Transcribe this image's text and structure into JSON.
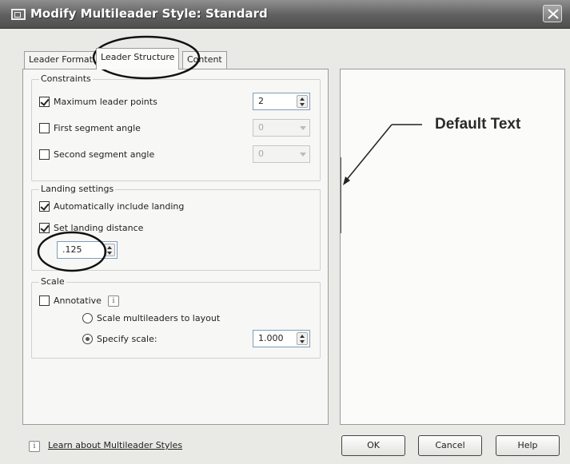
{
  "window": {
    "title": "Modify Multileader Style: Standard"
  },
  "tabs": [
    {
      "label": "Leader Format"
    },
    {
      "label": "Leader Structure"
    },
    {
      "label": "Content"
    }
  ],
  "constraints": {
    "group_label": "Constraints",
    "max_leader_points": {
      "label": "Maximum leader points",
      "checked": true,
      "value": "2"
    },
    "first_segment_angle": {
      "label": "First segment angle",
      "checked": false,
      "value": "0"
    },
    "second_segment_angle": {
      "label": "Second segment angle",
      "checked": false,
      "value": "0"
    }
  },
  "landing": {
    "group_label": "Landing settings",
    "auto_include": {
      "label": "Automatically include landing",
      "checked": true
    },
    "set_distance": {
      "label": "Set landing distance",
      "checked": true,
      "value": ".125"
    }
  },
  "scale": {
    "group_label": "Scale",
    "annotative": {
      "label": "Annotative",
      "checked": false
    },
    "scale_to_layout": {
      "label": "Scale multileaders to layout",
      "selected": false
    },
    "specify_scale": {
      "label": "Specify scale:",
      "selected": true,
      "value": "1.000"
    }
  },
  "preview": {
    "text": "Default Text"
  },
  "footer": {
    "learn_link": "Learn about Multileader Styles",
    "ok": "OK",
    "cancel": "Cancel",
    "help": "Help"
  },
  "colors": {
    "titlebar": "#5f5f5f",
    "annotation": "#111111"
  }
}
